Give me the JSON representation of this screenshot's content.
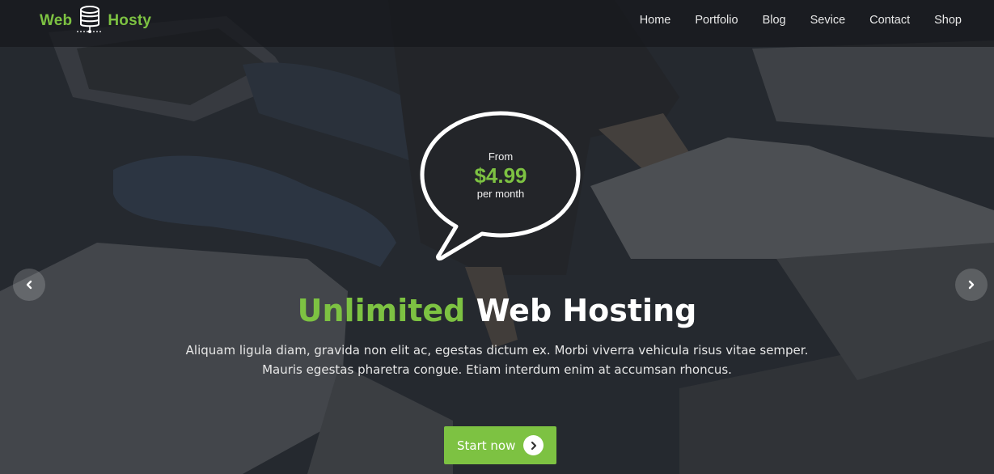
{
  "brand": {
    "name_left": "Web",
    "name_right": "Hosty",
    "logo_icon": "database-icon",
    "accent_color": "#7dc242"
  },
  "nav": {
    "items": [
      {
        "label": "Home"
      },
      {
        "label": "Portfolio"
      },
      {
        "label": "Blog"
      },
      {
        "label": "Sevice"
      },
      {
        "label": "Contact"
      },
      {
        "label": "Shop"
      }
    ]
  },
  "hero": {
    "bubble": {
      "from": "From",
      "price": "$4.99",
      "period": "per month"
    },
    "headline_accent": "Unlimited",
    "headline_rest": " Web Hosting",
    "description_lines": [
      "Aliquam ligula diam, gravida non elit ac, egestas dictum ex. Morbi viverra vehicula risus vitae semper.",
      "Mauris egestas pharetra congue. Etiam interdum enim at accumsan rhoncus."
    ],
    "cta_label": "Start now",
    "cta_icon": "chevron-right-icon",
    "prev_icon": "chevron-left-icon",
    "next_icon": "chevron-right-icon"
  },
  "colors": {
    "accent": "#7dc242",
    "topbar": "#16181c",
    "text_light": "#ffffff"
  }
}
